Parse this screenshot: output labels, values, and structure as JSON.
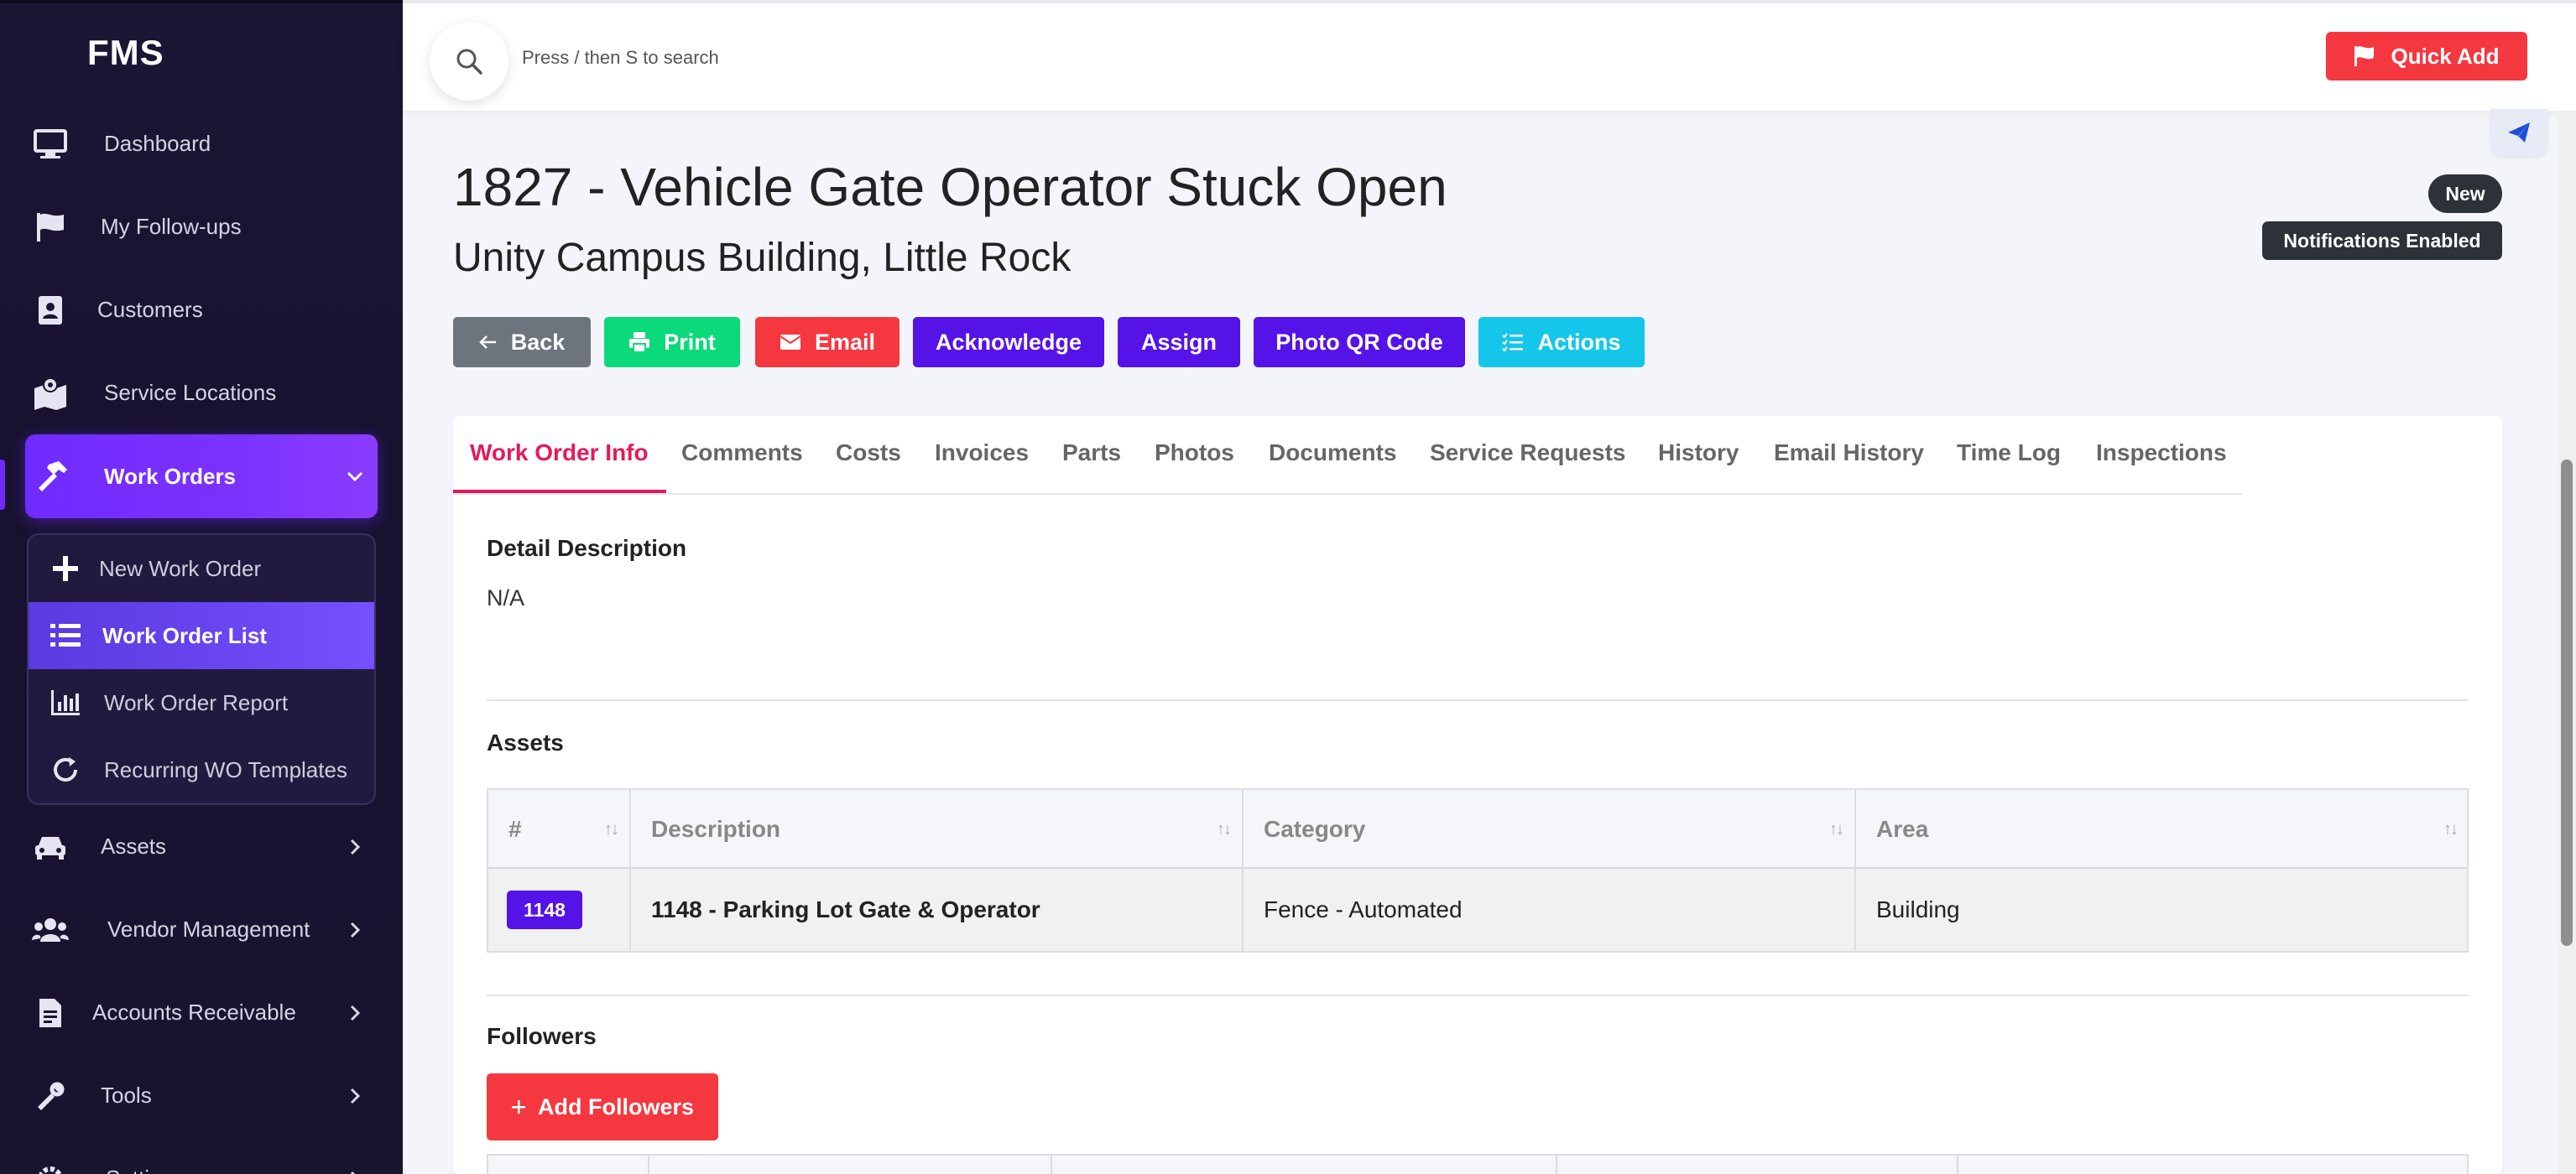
{
  "app": {
    "brand": "FMS"
  },
  "sidebar": {
    "items": [
      {
        "label": "Dashboard"
      },
      {
        "label": "My Follow-ups"
      },
      {
        "label": "Customers"
      },
      {
        "label": "Service Locations"
      },
      {
        "label": "Work Orders"
      },
      {
        "label": "Assets"
      },
      {
        "label": "Vendor Management"
      },
      {
        "label": "Accounts Receivable"
      },
      {
        "label": "Tools"
      },
      {
        "label": "Settings"
      }
    ],
    "submenu": [
      {
        "label": "New Work Order"
      },
      {
        "label": "Work Order List"
      },
      {
        "label": "Work Order Report"
      },
      {
        "label": "Recurring WO Templates"
      }
    ]
  },
  "topbar": {
    "search_hint": "Press / then S to search",
    "quick_add": "Quick Add"
  },
  "page": {
    "title": "1827 - Vehicle Gate Operator Stuck Open",
    "subtitle": "Unity Campus Building, Little Rock",
    "badge_status": "New",
    "badge_notifications": "Notifications Enabled"
  },
  "actions": {
    "back": "Back",
    "print": "Print",
    "email": "Email",
    "acknowledge": "Acknowledge",
    "assign": "Assign",
    "photo_qr": "Photo QR Code",
    "actions": "Actions"
  },
  "colors": {
    "back": "#6c757d",
    "print": "#0bd97a",
    "email": "#f5373f",
    "purple": "#5513e8",
    "cyan": "#14c6ea",
    "accent_tab": "#e5195c"
  },
  "tabs": [
    {
      "label": "Work Order Info"
    },
    {
      "label": "Comments"
    },
    {
      "label": "Costs"
    },
    {
      "label": "Invoices"
    },
    {
      "label": "Parts"
    },
    {
      "label": "Photos"
    },
    {
      "label": "Documents"
    },
    {
      "label": "Service Requests"
    },
    {
      "label": "History"
    },
    {
      "label": "Email History"
    },
    {
      "label": "Time Log"
    },
    {
      "label": "Inspections"
    }
  ],
  "detail": {
    "heading": "Detail Description",
    "text": "N/A"
  },
  "assets": {
    "heading": "Assets",
    "columns": [
      "#",
      "Description",
      "Category",
      "Area"
    ],
    "rows": [
      {
        "id": "1148",
        "description": "1148 - Parking Lot Gate & Operator",
        "category": "Fence - Automated",
        "area": "Building"
      }
    ]
  },
  "followers": {
    "heading": "Followers",
    "add_button": "Add Followers"
  }
}
